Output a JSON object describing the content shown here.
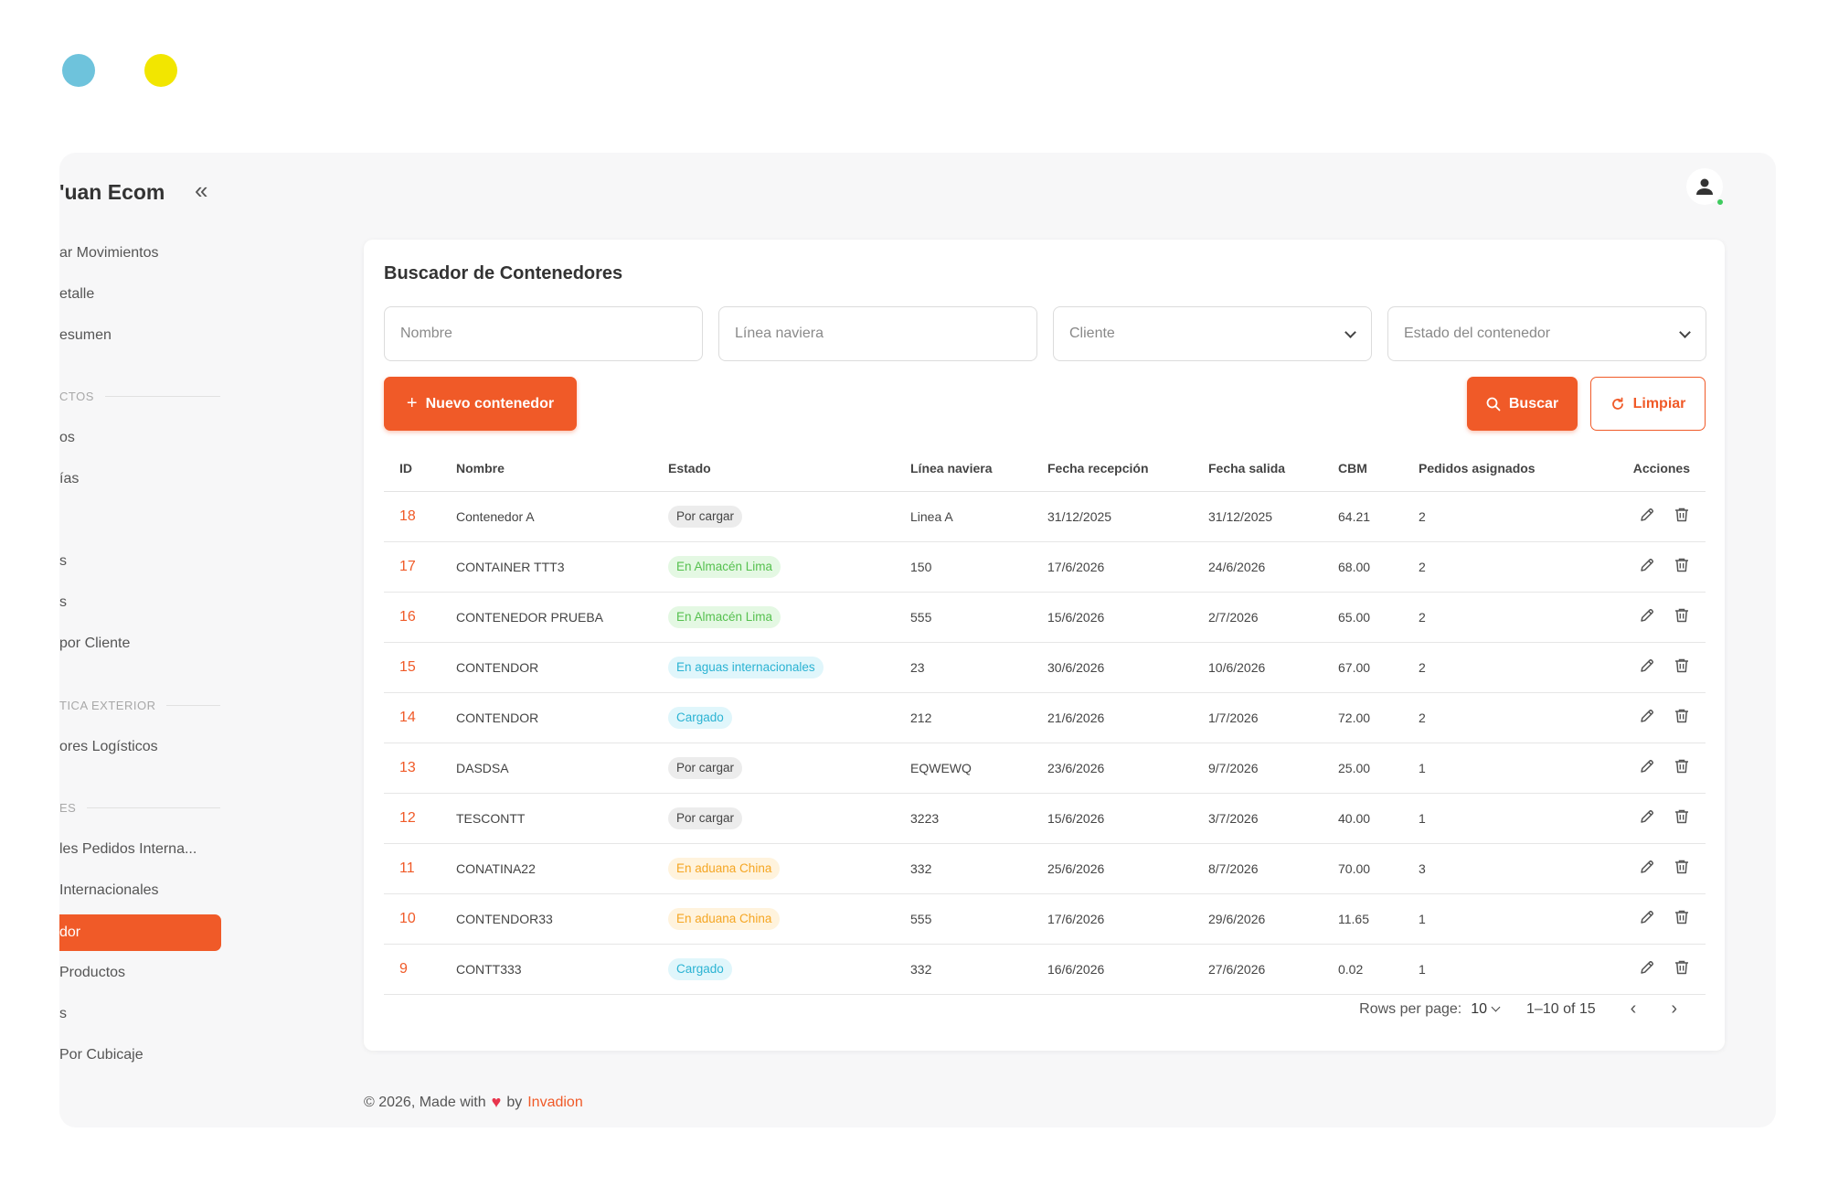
{
  "sidebar": {
    "brand": "'uan Ecom",
    "items": [
      {
        "label": "ar Movimientos"
      },
      {
        "label": "etalle"
      },
      {
        "label": "esumen"
      },
      {
        "label": "os"
      },
      {
        "label": "ías"
      },
      {
        "label": "s"
      },
      {
        "label": "s"
      },
      {
        "label": "por Cliente"
      },
      {
        "label": "ores Logísticos"
      },
      {
        "label": "les Pedidos Interna..."
      },
      {
        "label": "Internacionales"
      },
      {
        "label": "dor"
      },
      {
        "label": "Productos"
      },
      {
        "label": "s"
      },
      {
        "label": "Por Cubicaje"
      }
    ],
    "sections": [
      {
        "label": "CTOS"
      },
      {
        "label": "TICA EXTERIOR"
      },
      {
        "label": "ES"
      }
    ]
  },
  "card": {
    "title": "Buscador de Contenedores",
    "filters": {
      "nombre_placeholder": "Nombre",
      "linea_placeholder": "Línea naviera",
      "cliente_placeholder": "Cliente",
      "estado_placeholder": "Estado del contenedor"
    },
    "buttons": {
      "nuevo": "Nuevo contenedor",
      "buscar": "Buscar",
      "limpiar": "Limpiar"
    },
    "table": {
      "headers": [
        "ID",
        "Nombre",
        "Estado",
        "Línea naviera",
        "Fecha recepción",
        "Fecha salida",
        "CBM",
        "Pedidos asignados",
        "Acciones"
      ],
      "rows": [
        {
          "id": "18",
          "nombre": "Contenedor A",
          "estado": "Por cargar",
          "linea": "Linea A",
          "recepcion": "31/12/2025",
          "salida": "31/12/2025",
          "cbm": "64.21",
          "pedidos": "2"
        },
        {
          "id": "17",
          "nombre": "CONTAINER TTT3",
          "estado": "En Almacén Lima",
          "linea": "150",
          "recepcion": "17/6/2026",
          "salida": "24/6/2026",
          "cbm": "68.00",
          "pedidos": "2"
        },
        {
          "id": "16",
          "nombre": "CONTENEDOR PRUEBA",
          "estado": "En Almacén Lima",
          "linea": "555",
          "recepcion": "15/6/2026",
          "salida": "2/7/2026",
          "cbm": "65.00",
          "pedidos": "2"
        },
        {
          "id": "15",
          "nombre": "CONTENDOR",
          "estado": "En aguas internacionales",
          "linea": "23",
          "recepcion": "30/6/2026",
          "salida": "10/6/2026",
          "cbm": "67.00",
          "pedidos": "2"
        },
        {
          "id": "14",
          "nombre": "CONTENDOR",
          "estado": "Cargado",
          "linea": "212",
          "recepcion": "21/6/2026",
          "salida": "1/7/2026",
          "cbm": "72.00",
          "pedidos": "2"
        },
        {
          "id": "13",
          "nombre": "DASDSA",
          "estado": "Por cargar",
          "linea": "EQWEWQ",
          "recepcion": "23/6/2026",
          "salida": "9/7/2026",
          "cbm": "25.00",
          "pedidos": "1"
        },
        {
          "id": "12",
          "nombre": "TESCONTT",
          "estado": "Por cargar",
          "linea": "3223",
          "recepcion": "15/6/2026",
          "salida": "3/7/2026",
          "cbm": "40.00",
          "pedidos": "1"
        },
        {
          "id": "11",
          "nombre": "CONATINA22",
          "estado": "En aduana China",
          "linea": "332",
          "recepcion": "25/6/2026",
          "salida": "8/7/2026",
          "cbm": "70.00",
          "pedidos": "3"
        },
        {
          "id": "10",
          "nombre": "CONTENDOR33",
          "estado": "En aduana China",
          "linea": "555",
          "recepcion": "17/6/2026",
          "salida": "29/6/2026",
          "cbm": "11.65",
          "pedidos": "1"
        },
        {
          "id": "9",
          "nombre": "CONTT333",
          "estado": "Cargado",
          "linea": "332",
          "recepcion": "16/6/2026",
          "salida": "27/6/2026",
          "cbm": "0.02",
          "pedidos": "1"
        }
      ]
    },
    "pagination": {
      "rows_per_page_label": "Rows per page:",
      "rows_per_page_value": "10",
      "range": "1–10 of 15"
    }
  },
  "status_colors": {
    "Por cargar": {
      "bg": "#ececec",
      "fg": "#444444"
    },
    "En Almacén Lima": {
      "bg": "#e4f8e3",
      "fg": "#56c14f"
    },
    "En aguas internacionales": {
      "bg": "#e0f6fb",
      "fg": "#2bb3d3"
    },
    "Cargado": {
      "bg": "#e0f6fb",
      "fg": "#2bb3d3"
    },
    "En aduana China": {
      "bg": "#fff3dd",
      "fg": "#f5a623"
    }
  },
  "footer": {
    "prefix": "© 2026, Made with",
    "by": "by",
    "brand": "Invadion"
  },
  "colors": {
    "accent": "#f05a28"
  }
}
